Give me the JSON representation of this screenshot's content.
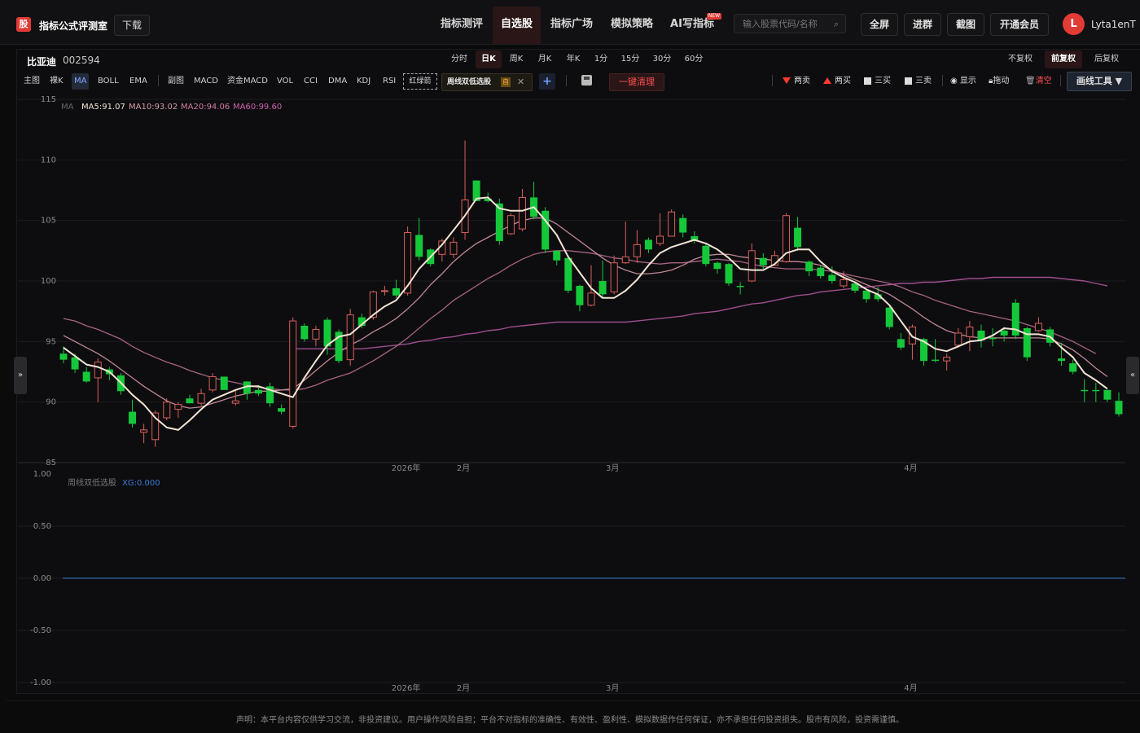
{
  "app": {
    "logo_char": "股",
    "title": "指标公式评测室",
    "download": "下载"
  },
  "nav": [
    {
      "label": "指标测评"
    },
    {
      "label": "自选股"
    },
    {
      "label": "指标广场"
    },
    {
      "label": "模拟策略"
    },
    {
      "label": "AI写指标"
    }
  ],
  "new_badge": "NEW",
  "search": {
    "placeholder": "输入股票代码/名称"
  },
  "top_buttons": [
    {
      "label": "全屏"
    },
    {
      "label": "进群"
    },
    {
      "label": "截图"
    },
    {
      "label": "开通会员"
    }
  ],
  "user": {
    "initial": "L",
    "name": "Lyta1enT"
  },
  "stock": {
    "name": "比亚迪",
    "code": "002594"
  },
  "periods": [
    {
      "label": "分时"
    },
    {
      "label": "日K"
    },
    {
      "label": "周K"
    },
    {
      "label": "月K"
    },
    {
      "label": "年K"
    },
    {
      "label": "1分"
    },
    {
      "label": "15分"
    },
    {
      "label": "30分"
    },
    {
      "label": "60分"
    }
  ],
  "adjust": [
    {
      "label": "不复权"
    },
    {
      "label": "前复权"
    },
    {
      "label": "后复权"
    }
  ],
  "indicators": [
    {
      "label": "主图"
    },
    {
      "label": "裸K"
    },
    {
      "label": "MA"
    },
    {
      "label": "BOLL"
    },
    {
      "label": "EMA"
    },
    {
      "label": "副图"
    },
    {
      "label": "MACD"
    },
    {
      "label": "资金MACD"
    },
    {
      "label": "VOL"
    },
    {
      "label": "CCI"
    },
    {
      "label": "DMA"
    },
    {
      "label": "KDJ"
    },
    {
      "label": "RSI"
    }
  ],
  "hongluo": "红绿箭",
  "formula_chip": {
    "label": "周线双低选股",
    "tag": "自",
    "close": "✕"
  },
  "clear_all": "一键清理",
  "right_tools": [
    {
      "label": "两卖"
    },
    {
      "label": "两买"
    },
    {
      "label": "三买"
    },
    {
      "label": "三卖"
    },
    {
      "label": "显示"
    },
    {
      "label": "拖动"
    },
    {
      "label": "清空"
    }
  ],
  "draw_tool": "画线工具 ▼",
  "side_left": "»",
  "side_right": "«",
  "legend": {
    "ma": "MA",
    "ma5": "MA5:91.07",
    "ma10": "MA10:93.02",
    "ma20": "MA20:94.06",
    "ma60": "MA60:99.60"
  },
  "sub_legend": {
    "name": "周线双低选股",
    "xg": "XG:0.000"
  },
  "disclaimer": "声明：本平台内容仅供学习交流，非投资建议。用户操作风险自担；平台不对指标的准确性、有效性、盈利性、模拟数据作任何保证，亦不承担任何投资损失。股市有风险，投资需谨慎。",
  "colors": {
    "up": "#d9605a",
    "down": "#15c83a",
    "ma5": "#f2e3d3",
    "ma10": "#c08794",
    "ma20": "#a76383",
    "ma60": "#9f4e8f",
    "xg": "#3b7bd6",
    "accent": "#e23b36"
  },
  "chart_data": {
    "type": "candlestick",
    "price_axis": {
      "ylim": [
        85,
        115
      ],
      "ticks": [
        85,
        90,
        95,
        100,
        105,
        110,
        115
      ]
    },
    "sub_axis": {
      "ylim": [
        -1,
        1
      ],
      "ticks": [
        "1.00",
        "0.50",
        "0.00",
        "-0.50",
        "-1.00"
      ]
    },
    "date_labels": [
      "2026年",
      "2月",
      "3月",
      "4月"
    ],
    "candles": [
      {
        "o": 94.0,
        "h": 94.6,
        "c": 93.5,
        "l": 93.2
      },
      {
        "o": 93.7,
        "h": 94.0,
        "c": 92.7,
        "l": 92.4
      },
      {
        "o": 92.5,
        "h": 92.9,
        "c": 91.7,
        "l": 91.6
      },
      {
        "o": 92.0,
        "h": 93.6,
        "c": 93.3,
        "l": 90.0
      },
      {
        "o": 92.7,
        "h": 92.9,
        "c": 92.3,
        "l": 91.8
      },
      {
        "o": 92.2,
        "h": 92.4,
        "c": 90.9,
        "l": 90.6
      },
      {
        "o": 89.2,
        "h": 90.2,
        "c": 88.2,
        "l": 87.9
      },
      {
        "o": 87.5,
        "h": 88.2,
        "c": 87.7,
        "l": 86.6
      },
      {
        "o": 86.9,
        "h": 89.3,
        "c": 89.1,
        "l": 86.3
      },
      {
        "o": 88.7,
        "h": 90.3,
        "c": 90.0,
        "l": 88.5
      },
      {
        "o": 89.4,
        "h": 90.0,
        "c": 89.8,
        "l": 88.7
      },
      {
        "o": 90.3,
        "h": 90.6,
        "c": 89.9,
        "l": 89.9
      },
      {
        "o": 89.9,
        "h": 91.1,
        "c": 90.7,
        "l": 89.7
      },
      {
        "o": 91.0,
        "h": 92.4,
        "c": 92.1,
        "l": 90.8
      },
      {
        "o": 92.1,
        "h": 92.1,
        "c": 91.0,
        "l": 91.0
      },
      {
        "o": 89.9,
        "h": 91.0,
        "c": 90.1,
        "l": 89.7
      },
      {
        "o": 91.7,
        "h": 91.7,
        "c": 90.7,
        "l": 90.2
      },
      {
        "o": 91.0,
        "h": 91.4,
        "c": 90.7,
        "l": 90.5
      },
      {
        "o": 91.3,
        "h": 91.6,
        "c": 89.9,
        "l": 89.6
      },
      {
        "o": 89.5,
        "h": 89.8,
        "c": 89.2,
        "l": 89.0
      },
      {
        "o": 88.0,
        "h": 97.0,
        "c": 96.7,
        "l": 87.8
      },
      {
        "o": 96.3,
        "h": 96.5,
        "c": 95.2,
        "l": 95.0
      },
      {
        "o": 95.2,
        "h": 96.3,
        "c": 96.0,
        "l": 94.6
      },
      {
        "o": 96.8,
        "h": 97.0,
        "c": 94.6,
        "l": 93.9
      },
      {
        "o": 95.8,
        "h": 96.0,
        "c": 93.4,
        "l": 93.2
      },
      {
        "o": 93.5,
        "h": 97.7,
        "c": 97.2,
        "l": 93.0
      },
      {
        "o": 97.0,
        "h": 97.3,
        "c": 96.3,
        "l": 96.1
      },
      {
        "o": 97.0,
        "h": 99.2,
        "c": 99.1,
        "l": 96.8
      },
      {
        "o": 99.2,
        "h": 99.6,
        "c": 99.2,
        "l": 98.8
      },
      {
        "o": 99.4,
        "h": 100.1,
        "c": 98.8,
        "l": 98.6
      },
      {
        "o": 99.0,
        "h": 104.5,
        "c": 104.0,
        "l": 98.8
      },
      {
        "o": 103.8,
        "h": 105.2,
        "c": 102.0,
        "l": 101.7
      },
      {
        "o": 102.6,
        "h": 102.7,
        "c": 101.4,
        "l": 101.2
      },
      {
        "o": 102.2,
        "h": 103.5,
        "c": 103.3,
        "l": 101.6
      },
      {
        "o": 102.2,
        "h": 103.6,
        "c": 103.2,
        "l": 101.9
      },
      {
        "o": 104.0,
        "h": 111.6,
        "c": 106.7,
        "l": 103.4
      },
      {
        "o": 108.3,
        "h": 108.3,
        "c": 106.6,
        "l": 106.6
      },
      {
        "o": 106.8,
        "h": 107.3,
        "c": 106.6,
        "l": 106.5
      },
      {
        "o": 106.4,
        "h": 106.8,
        "c": 103.3,
        "l": 103.0
      },
      {
        "o": 103.9,
        "h": 105.6,
        "c": 105.4,
        "l": 103.8
      },
      {
        "o": 104.3,
        "h": 107.6,
        "c": 106.9,
        "l": 104.1
      },
      {
        "o": 106.9,
        "h": 108.2,
        "c": 105.3,
        "l": 105.1
      },
      {
        "o": 105.8,
        "h": 106.1,
        "c": 102.6,
        "l": 102.3
      },
      {
        "o": 102.5,
        "h": 102.5,
        "c": 101.7,
        "l": 101.3
      },
      {
        "o": 101.9,
        "h": 102.1,
        "c": 99.2,
        "l": 99.0
      },
      {
        "o": 99.6,
        "h": 99.7,
        "c": 98.0,
        "l": 97.5
      },
      {
        "o": 98.0,
        "h": 101.3,
        "c": 99.0,
        "l": 97.9
      },
      {
        "o": 100.0,
        "h": 101.7,
        "c": 98.9,
        "l": 98.6
      },
      {
        "o": 99.1,
        "h": 102.1,
        "c": 101.5,
        "l": 98.9
      },
      {
        "o": 101.5,
        "h": 104.9,
        "c": 102.0,
        "l": 101.4
      },
      {
        "o": 102.0,
        "h": 104.2,
        "c": 103.0,
        "l": 101.5
      },
      {
        "o": 103.4,
        "h": 103.6,
        "c": 102.6,
        "l": 102.3
      },
      {
        "o": 103.1,
        "h": 105.6,
        "c": 103.7,
        "l": 102.9
      },
      {
        "o": 103.7,
        "h": 105.9,
        "c": 105.7,
        "l": 103.7
      },
      {
        "o": 105.2,
        "h": 105.5,
        "c": 104.0,
        "l": 103.6
      },
      {
        "o": 103.7,
        "h": 104.1,
        "c": 103.3,
        "l": 103.1
      },
      {
        "o": 102.9,
        "h": 103.1,
        "c": 101.4,
        "l": 101.2
      },
      {
        "o": 101.5,
        "h": 101.6,
        "c": 101.0,
        "l": 100.6
      },
      {
        "o": 101.4,
        "h": 101.5,
        "c": 99.8,
        "l": 99.6
      },
      {
        "o": 99.6,
        "h": 99.9,
        "c": 99.5,
        "l": 98.9
      },
      {
        "o": 100.0,
        "h": 103.1,
        "c": 102.5,
        "l": 99.9
      },
      {
        "o": 101.9,
        "h": 102.3,
        "c": 101.3,
        "l": 101.0
      },
      {
        "o": 101.3,
        "h": 102.5,
        "c": 102.1,
        "l": 101.3
      },
      {
        "o": 101.6,
        "h": 105.6,
        "c": 105.4,
        "l": 101.5
      },
      {
        "o": 104.4,
        "h": 105.3,
        "c": 102.8,
        "l": 102.5
      },
      {
        "o": 101.6,
        "h": 101.7,
        "c": 100.8,
        "l": 100.4
      },
      {
        "o": 101.1,
        "h": 101.3,
        "c": 100.4,
        "l": 100.2
      },
      {
        "o": 100.5,
        "h": 101.2,
        "c": 100.0,
        "l": 99.8
      },
      {
        "o": 99.6,
        "h": 100.8,
        "c": 100.1,
        "l": 99.4
      },
      {
        "o": 99.8,
        "h": 99.9,
        "c": 99.2,
        "l": 99.0
      },
      {
        "o": 99.2,
        "h": 99.4,
        "c": 98.5,
        "l": 98.2
      },
      {
        "o": 98.9,
        "h": 99.5,
        "c": 98.5,
        "l": 98.3
      },
      {
        "o": 97.8,
        "h": 97.9,
        "c": 96.2,
        "l": 96.0
      },
      {
        "o": 95.2,
        "h": 95.7,
        "c": 94.5,
        "l": 94.3
      },
      {
        "o": 94.8,
        "h": 96.4,
        "c": 96.2,
        "l": 93.5
      },
      {
        "o": 95.2,
        "h": 95.3,
        "c": 93.4,
        "l": 93.0
      },
      {
        "o": 93.5,
        "h": 95.2,
        "c": 93.4,
        "l": 93.3
      },
      {
        "o": 93.4,
        "h": 94.0,
        "c": 93.7,
        "l": 92.6
      },
      {
        "o": 94.7,
        "h": 96.1,
        "c": 95.7,
        "l": 94.5
      },
      {
        "o": 95.4,
        "h": 96.7,
        "c": 96.2,
        "l": 94.2
      },
      {
        "o": 95.9,
        "h": 96.4,
        "c": 95.1,
        "l": 94.5
      },
      {
        "o": 95.3,
        "h": 96.1,
        "c": 95.2,
        "l": 94.6
      },
      {
        "o": 95.9,
        "h": 96.2,
        "c": 95.5,
        "l": 95.0
      },
      {
        "o": 98.2,
        "h": 98.5,
        "c": 95.5,
        "l": 95.2
      },
      {
        "o": 96.1,
        "h": 96.2,
        "c": 93.7,
        "l": 93.4
      },
      {
        "o": 95.9,
        "h": 97.0,
        "c": 96.5,
        "l": 95.8
      },
      {
        "o": 96.0,
        "h": 96.2,
        "c": 94.9,
        "l": 94.6
      },
      {
        "o": 93.6,
        "h": 94.9,
        "c": 93.4,
        "l": 93.0
      },
      {
        "o": 93.2,
        "h": 93.5,
        "c": 92.5,
        "l": 92.3
      },
      {
        "o": 91.0,
        "h": 91.9,
        "c": 90.9,
        "l": 90.0
      },
      {
        "o": 91.0,
        "h": 91.6,
        "c": 90.9,
        "l": 90.0
      },
      {
        "o": 91.0,
        "h": 91.0,
        "c": 90.2,
        "l": 90.0
      },
      {
        "o": 90.1,
        "h": 90.8,
        "c": 89.0,
        "l": 88.8
      }
    ],
    "ma5": [
      94.5,
      93.8,
      93.1,
      92.9,
      92.5,
      91.6,
      90.6,
      89.8,
      88.7,
      87.9,
      87.7,
      88.5,
      89.4,
      90.2,
      90.6,
      91.0,
      91.3,
      91.3,
      91.0,
      90.7,
      90.4,
      92.0,
      93.4,
      94.7,
      95.4,
      95.6,
      96.4,
      97.2,
      97.9,
      98.4,
      99.6,
      101.0,
      102.0,
      103.0,
      104.2,
      105.4,
      106.8,
      106.9,
      106.0,
      105.8,
      105.8,
      106.1,
      105.0,
      103.8,
      102.0,
      100.7,
      99.4,
      98.6,
      98.6,
      99.2,
      100.1,
      101.3,
      102.3,
      102.8,
      103.1,
      103.4,
      103.1,
      102.6,
      101.9,
      101.0,
      100.9,
      100.9,
      101.4,
      102.3,
      102.6,
      102.6,
      101.6,
      100.8,
      100.3,
      99.9,
      99.3,
      98.9,
      98.0,
      96.7,
      95.4,
      95.0,
      94.4,
      94.2,
      94.6,
      95.0,
      95.1,
      95.5,
      96.1,
      96.0,
      95.6,
      95.6,
      95.4,
      94.5,
      93.7,
      92.4,
      91.8,
      91.1
    ],
    "ma10": [
      95.5,
      95.0,
      94.5,
      94.0,
      93.4,
      92.7,
      92.0,
      91.3,
      90.7,
      90.1,
      89.7,
      89.5,
      89.6,
      89.9,
      90.2,
      90.5,
      90.7,
      90.9,
      90.9,
      91.0,
      91.1,
      91.8,
      92.6,
      93.4,
      94.1,
      94.7,
      95.2,
      95.8,
      96.3,
      96.9,
      97.7,
      98.6,
      99.7,
      100.6,
      101.6,
      102.4,
      103.1,
      103.6,
      104.1,
      104.6,
      105.0,
      105.2,
      105.2,
      104.7,
      104.0,
      103.3,
      102.6,
      101.9,
      101.3,
      100.9,
      100.6,
      100.6,
      100.7,
      100.9,
      101.3,
      101.8,
      102.1,
      102.2,
      102.2,
      102.0,
      101.9,
      101.8,
      101.7,
      101.6,
      101.6,
      101.5,
      101.3,
      100.9,
      100.5,
      100.1,
      99.7,
      99.3,
      98.9,
      98.3,
      97.7,
      97.0,
      96.4,
      95.9,
      95.6,
      95.4,
      95.3,
      95.3,
      95.3,
      95.3,
      95.3,
      95.3,
      95.2,
      94.8,
      94.3,
      93.6,
      92.8,
      92.1
    ],
    "ma20": [
      96.9,
      96.7,
      96.3,
      96.0,
      95.6,
      95.2,
      94.6,
      94.1,
      93.7,
      93.3,
      93.0,
      92.6,
      92.3,
      92.0,
      91.8,
      91.6,
      91.4,
      91.2,
      91.1,
      91.0,
      91.0,
      91.1,
      91.4,
      91.8,
      92.1,
      92.4,
      92.9,
      93.4,
      94.0,
      94.6,
      95.3,
      96.1,
      96.9,
      97.6,
      98.4,
      99.0,
      99.6,
      100.2,
      100.7,
      101.3,
      101.8,
      102.2,
      102.4,
      102.5,
      102.5,
      102.4,
      102.3,
      102.1,
      101.9,
      101.8,
      101.6,
      101.5,
      101.4,
      101.5,
      101.5,
      101.6,
      101.7,
      101.8,
      101.7,
      101.6,
      101.4,
      101.2,
      101.1,
      101.0,
      101.0,
      101.0,
      100.9,
      100.8,
      100.6,
      100.4,
      100.2,
      100.0,
      99.8,
      99.5,
      99.1,
      98.8,
      98.4,
      98.1,
      97.8,
      97.5,
      97.3,
      97.1,
      96.9,
      96.7,
      96.4,
      96.1,
      95.8,
      95.4,
      95.0,
      94.5,
      94.0
    ],
    "ma60": [
      null,
      null,
      null,
      null,
      null,
      null,
      null,
      null,
      null,
      null,
      null,
      null,
      null,
      null,
      null,
      null,
      null,
      null,
      null,
      null,
      94.4,
      94.4,
      94.4,
      94.4,
      94.4,
      94.4,
      94.4,
      94.5,
      94.6,
      94.7,
      94.8,
      95.0,
      95.1,
      95.3,
      95.4,
      95.6,
      95.7,
      95.9,
      96.0,
      96.2,
      96.3,
      96.4,
      96.5,
      96.6,
      96.6,
      96.6,
      96.6,
      96.6,
      96.6,
      96.6,
      96.7,
      96.8,
      96.9,
      97.0,
      97.1,
      97.3,
      97.4,
      97.5,
      97.7,
      97.9,
      98.1,
      98.2,
      98.4,
      98.6,
      98.8,
      98.9,
      99.1,
      99.2,
      99.3,
      99.4,
      99.5,
      99.6,
      99.7,
      99.8,
      99.8,
      99.9,
      99.9,
      100.0,
      100.1,
      100.2,
      100.2,
      100.3,
      100.3,
      100.3,
      100.3,
      100.3,
      100.3,
      100.2,
      100.1,
      100.0,
      99.8,
      99.6
    ],
    "xg": 0.0
  }
}
